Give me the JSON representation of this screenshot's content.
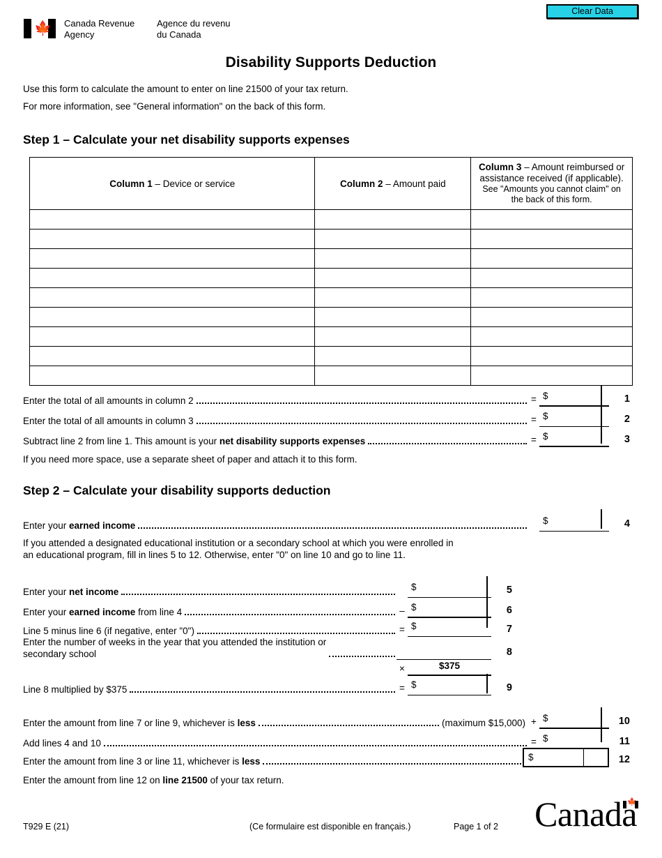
{
  "toolbar": {
    "clear_data_label": "Clear Data",
    "clear_data_color": "#28d2e6"
  },
  "agency": {
    "name_en_line1": "Canada Revenue",
    "name_en_line2": "Agency",
    "name_fr_line1": "Agence du revenu",
    "name_fr_line2": "du Canada",
    "flag_icon": "canada-flag-icon"
  },
  "form": {
    "title": "Disability Supports Deduction",
    "intro_line1": "Use this form to calculate the amount to enter on line 21500 of your tax return.",
    "intro_line2": "For more information, see \"General information\" on the back of this form."
  },
  "step1": {
    "heading": "Step 1 – Calculate your net disability supports expenses",
    "table": {
      "col1_bold": "Column 1",
      "col1_rest": " – Device or service",
      "col2_bold": "Column 2",
      "col2_rest": " – Amount paid",
      "col3_bold": "Column 3",
      "col3_rest": " – Amount reimbursed or assistance received (if applicable).",
      "col3_note": "See \"Amounts you cannot claim\" on the back of this form.",
      "empty_row_count": 9,
      "rows": [
        {
          "col1": "",
          "col2": "",
          "col3": ""
        },
        {
          "col1": "",
          "col2": "",
          "col3": ""
        },
        {
          "col1": "",
          "col2": "",
          "col3": ""
        },
        {
          "col1": "",
          "col2": "",
          "col3": ""
        },
        {
          "col1": "",
          "col2": "",
          "col3": ""
        },
        {
          "col1": "",
          "col2": "",
          "col3": ""
        },
        {
          "col1": "",
          "col2": "",
          "col3": ""
        },
        {
          "col1": "",
          "col2": "",
          "col3": ""
        },
        {
          "col1": "",
          "col2": "",
          "col3": ""
        }
      ]
    },
    "line1": {
      "label": "Enter the total of all amounts in column 2",
      "operator": "=",
      "dollar": "$",
      "value": "",
      "number": "1"
    },
    "line2": {
      "label": "Enter the total of all amounts in column 3",
      "operator": "=",
      "dollar": "$",
      "value": "",
      "number": "2"
    },
    "line3": {
      "label_a": "Subtract line 2 from line 1. This amount is your ",
      "label_b": "net disability supports expenses",
      "operator": "=",
      "dollar": "$",
      "value": "",
      "number": "3"
    },
    "note_more_space": "If you need more space, use a separate sheet of paper and attach it to this form."
  },
  "step2": {
    "heading": "Step 2 – Calculate your disability supports deduction",
    "line4": {
      "label_a": "Enter your ",
      "label_b": "earned income",
      "operator": "",
      "dollar": "$",
      "value": "",
      "number": "4"
    },
    "note_attend_line1": "If you attended a designated educational institution or a secondary school at which you were enrolled in",
    "note_attend_line2": "an educational program, fill in lines 5 to 12. Otherwise, enter \"0\" on line 10 and go to line 11.",
    "line5": {
      "label_a": "Enter your ",
      "label_b": "net income",
      "label_c": "",
      "operator": "",
      "dollar": "$",
      "value": "",
      "number": "5"
    },
    "line6": {
      "label_a": "Enter your ",
      "label_b": "earned income",
      "label_c": " from line 4",
      "operator": "–",
      "dollar": "$",
      "value": "",
      "number": "6"
    },
    "line7": {
      "label": "Line 5 minus line 6 (if negative, enter \"0\")",
      "operator": "=",
      "dollar": "$",
      "value": "",
      "number": "7"
    },
    "line8": {
      "label_line1": "Enter the number of weeks in the year that you attended the institution or",
      "label_line2": "secondary school",
      "operator": "",
      "dollar": "",
      "value": "",
      "number": "8"
    },
    "multiplier": {
      "operator": "×",
      "value": "$375"
    },
    "line9": {
      "label": "Line 8 multiplied by $375",
      "operator": "=",
      "dollar": "$",
      "value": "",
      "number": "9"
    },
    "line10": {
      "label_a": "Enter the amount from line 7 or line 9, whichever is ",
      "label_b": "less",
      "maximum_note": "(maximum $15,000)",
      "operator": "+",
      "dollar": "$",
      "value": "",
      "number": "10"
    },
    "line11": {
      "label": "Add lines 4 and 10",
      "operator": "=",
      "dollar": "$",
      "value": "",
      "number": "11"
    },
    "line12": {
      "label_a": "Enter the amount from line 3 or line 11, whichever is ",
      "label_b": "less",
      "dollar": "$",
      "value": "",
      "number": "12"
    },
    "note_final_a": "Enter the amount from line 12 on ",
    "note_final_b": "line 21500",
    "note_final_c": " of your tax return."
  },
  "footer": {
    "form_code": "T929 E (21)",
    "french_note": "(Ce formulaire est disponible en français.)",
    "page_indicator": "Page 1 of 2",
    "wordmark": "Canada"
  }
}
